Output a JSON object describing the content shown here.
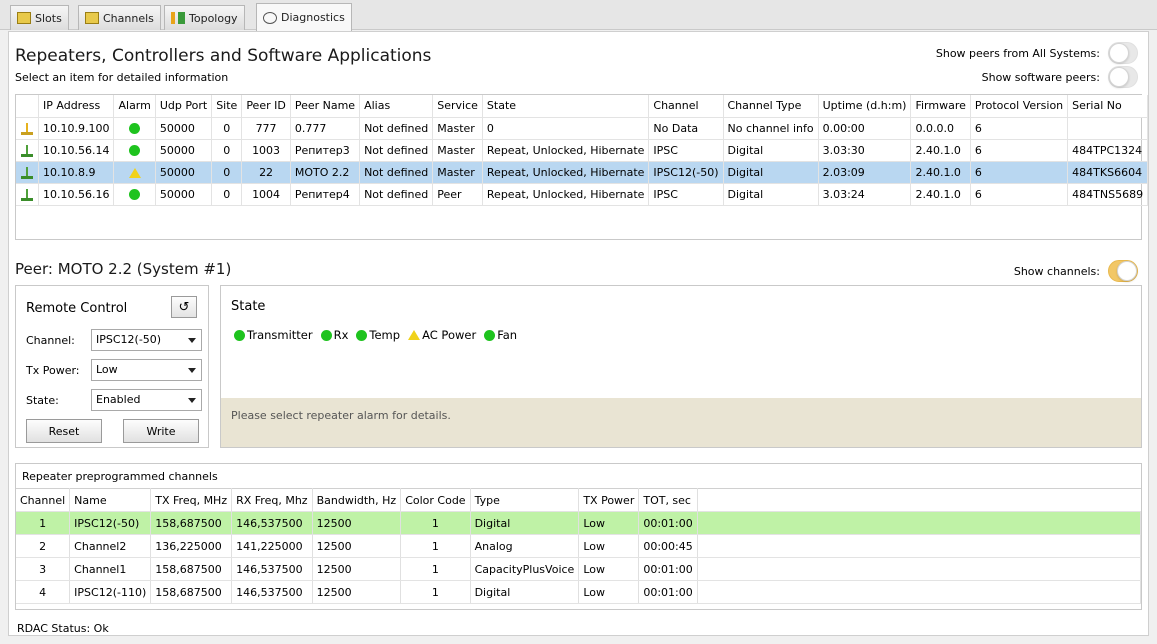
{
  "tabs": [
    {
      "label": "Slots",
      "icon": "slots-icon"
    },
    {
      "label": "Channels",
      "icon": "channels-icon"
    },
    {
      "label": "Topology",
      "icon": "topology-icon"
    },
    {
      "label": "Diagnostics",
      "icon": "diagnostics-icon"
    }
  ],
  "active_tab": "Diagnostics",
  "header": {
    "title": "Repeaters, Controllers and Software Applications",
    "subtitle": "Select an item for detailed information",
    "toggle_all_systems": "Show peers from All Systems:",
    "toggle_software": "Show software peers:"
  },
  "peers": {
    "columns": [
      "IP Address",
      "Alarm",
      "Udp Port",
      "Site",
      "Peer ID",
      "Peer Name",
      "Alias",
      "Service",
      "State",
      "Channel",
      "Channel Type",
      "Uptime (d.h:m)",
      "Firmware",
      "Protocol Version",
      "Serial No"
    ],
    "rows": [
      {
        "ip": "10.10.9.100",
        "alarm": "green",
        "udp": "50000",
        "site": "0",
        "peer_id": "777",
        "name": "0.777",
        "alias": "Not defined",
        "service": "Master",
        "state": "0",
        "channel": "No Data",
        "channel_type": "No channel info",
        "uptime": "0.00:00",
        "firmware": "0.0.0.0",
        "protocol": "6",
        "serial": "",
        "icon": "peer-warning-icon",
        "selected": false
      },
      {
        "ip": "10.10.56.14",
        "alarm": "green",
        "udp": "50000",
        "site": "0",
        "peer_id": "1003",
        "name": "Репитер3",
        "alias": "Not defined",
        "service": "Master",
        "state": "Repeat, Unlocked, Hibernate",
        "channel": "IPSC",
        "channel_type": "Digital",
        "uptime": "3.03:30",
        "firmware": "2.40.1.0",
        "protocol": "6",
        "serial": "484TPC1324",
        "icon": "peer-ok-icon",
        "selected": false
      },
      {
        "ip": "10.10.8.9",
        "alarm": "warning",
        "udp": "50000",
        "site": "0",
        "peer_id": "22",
        "name": "MOTO 2.2",
        "alias": "Not defined",
        "service": "Master",
        "state": "Repeat, Unlocked, Hibernate",
        "channel": "IPSC12(-50)",
        "channel_type": "Digital",
        "uptime": "2.03:09",
        "firmware": "2.40.1.0",
        "protocol": "6",
        "serial": "484TKS6604",
        "icon": "peer-ok-icon",
        "selected": true
      },
      {
        "ip": "10.10.56.16",
        "alarm": "green",
        "udp": "50000",
        "site": "0",
        "peer_id": "1004",
        "name": "Репитер4",
        "alias": "Not defined",
        "service": "Peer",
        "state": "Repeat, Unlocked, Hibernate",
        "channel": "IPSC",
        "channel_type": "Digital",
        "uptime": "3.03:24",
        "firmware": "2.40.1.0",
        "protocol": "6",
        "serial": "484TNS5689",
        "icon": "peer-ok-icon",
        "selected": false
      }
    ]
  },
  "peer_detail": {
    "title": "Peer: MOTO 2.2 (System #1)",
    "show_channels": "Show channels:"
  },
  "remote_control": {
    "title": "Remote Control",
    "channel_label": "Channel:",
    "channel_value": "IPSC12(-50)",
    "tx_power_label": "Tx Power:",
    "tx_power_value": "Low",
    "state_label": "State:",
    "state_value": "Enabled",
    "reset": "Reset",
    "write": "Write"
  },
  "state_panel": {
    "title": "State",
    "alarms": [
      {
        "label": "Transmitter",
        "status": "green"
      },
      {
        "label": "Rx",
        "status": "green"
      },
      {
        "label": "Temp",
        "status": "green"
      },
      {
        "label": "AC Power",
        "status": "warning"
      },
      {
        "label": "Fan",
        "status": "green"
      }
    ],
    "hint": "Please select repeater alarm for details."
  },
  "channels": {
    "title": "Repeater preprogrammed channels",
    "columns": [
      "Channel",
      "Name",
      "TX Freq, MHz",
      "RX Freq, Mhz",
      "Bandwidth, Hz",
      "Color Code",
      "Type",
      "TX Power",
      "TOT, sec"
    ],
    "rows": [
      {
        "channel": "1",
        "name": "IPSC12(-50)",
        "tx": "158,687500",
        "rx": "146,537500",
        "bw": "12500",
        "cc": "1",
        "type": "Digital",
        "power": "Low",
        "tot": "00:01:00",
        "highlight": true
      },
      {
        "channel": "2",
        "name": "Channel2",
        "tx": "136,225000",
        "rx": "141,225000",
        "bw": "12500",
        "cc": "1",
        "type": "Analog",
        "power": "Low",
        "tot": "00:00:45",
        "highlight": false
      },
      {
        "channel": "3",
        "name": "Channel1",
        "tx": "158,687500",
        "rx": "146,537500",
        "bw": "12500",
        "cc": "1",
        "type": "CapacityPlusVoice",
        "power": "Low",
        "tot": "00:01:00",
        "highlight": false
      },
      {
        "channel": "4",
        "name": "IPSC12(-110)",
        "tx": "158,687500",
        "rx": "146,537500",
        "bw": "12500",
        "cc": "1",
        "type": "Digital",
        "power": "Low",
        "tot": "00:01:00",
        "highlight": false
      }
    ]
  },
  "status_bar": "RDAC Status: Ok",
  "colors": {
    "ok": "#1ec31e",
    "warning": "#f0d21a",
    "selected_row": "#b9d7f1",
    "highlight_row": "#bff2a6",
    "toggle_on": "#f2c766"
  }
}
